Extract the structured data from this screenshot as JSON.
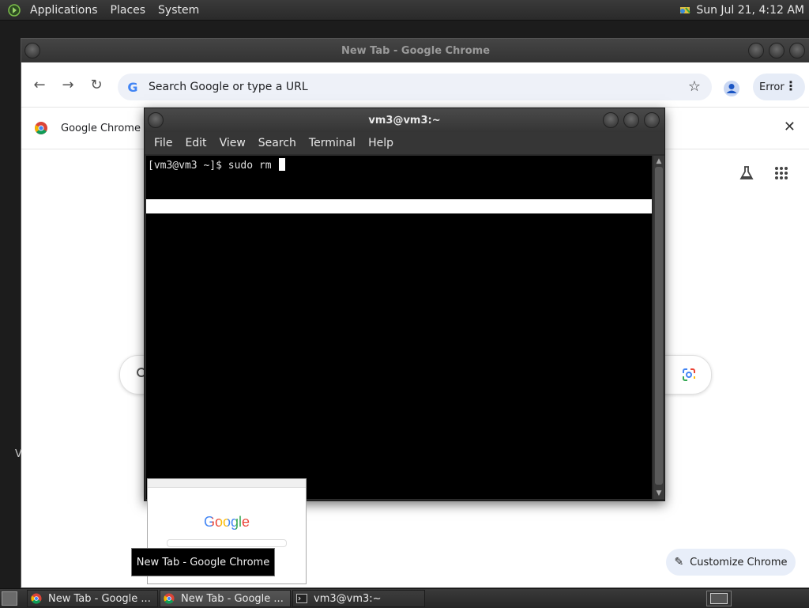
{
  "top_panel": {
    "menus": [
      "Applications",
      "Places",
      "System"
    ],
    "clock": "Sun Jul 21,  4:12 AM"
  },
  "chrome": {
    "title": "New Tab - Google Chrome",
    "omnibox_placeholder": "Search Google or type a URL",
    "error_label": "Error",
    "infobar_text": "Google Chrome isn't",
    "customize_label": "Customize Chrome",
    "left_text": "V"
  },
  "terminal": {
    "title": "vm3@vm3:~",
    "menu": [
      "File",
      "Edit",
      "View",
      "Search",
      "Terminal",
      "Help"
    ],
    "prompt": "[vm3@vm3 ~]$ sudo rm "
  },
  "thumbnail": {
    "logo_text": "Google"
  },
  "tooltip": "New Tab - Google Chrome",
  "taskbar": {
    "tasks": [
      {
        "label": "New Tab - Google ...",
        "icon": "chrome-icon"
      },
      {
        "label": "New Tab - Google ...",
        "icon": "chrome-icon"
      },
      {
        "label": "vm3@vm3:~",
        "icon": "terminal-icon"
      }
    ]
  },
  "colors": {
    "panel_bg": "#2f2f2f",
    "terminal_bg": "#000000",
    "omnibox_bg": "#eef1f8",
    "google_blue": "#4285f4"
  }
}
